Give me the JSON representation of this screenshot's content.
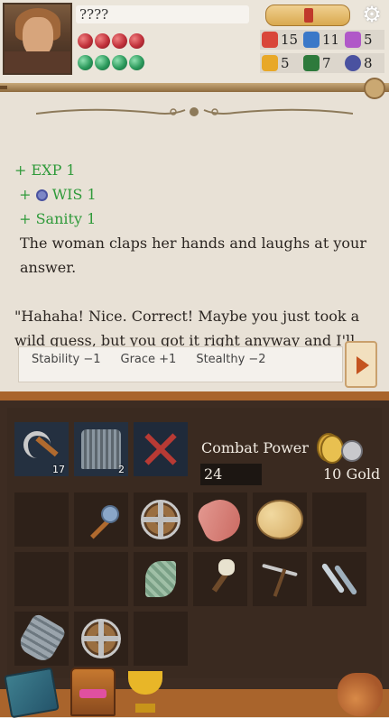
{
  "header": {
    "player_name": "????",
    "health_gems": 4,
    "sanity_gems": 4,
    "stats": [
      {
        "icon": "strength-icon",
        "value": "15",
        "color": "#d9463a"
      },
      {
        "icon": "agility-icon",
        "value": "11",
        "color": "#3a78c8"
      },
      {
        "icon": "magic-icon",
        "value": "5",
        "color": "#b058c8"
      },
      {
        "icon": "luck-icon",
        "value": "5",
        "color": "#e8a828"
      },
      {
        "icon": "defense-icon",
        "value": "7",
        "color": "#2e7a3c"
      },
      {
        "icon": "wisdom-icon",
        "value": "8",
        "color": "#4a52a0"
      }
    ]
  },
  "story": {
    "rewards": [
      {
        "prefix": "+ ",
        "label": "EXP 1",
        "icon": null
      },
      {
        "prefix": "+ ",
        "label": "WIS 1",
        "icon": "wisdom-icon"
      },
      {
        "prefix": "+ ",
        "label": "Sanity 1",
        "icon": null
      }
    ],
    "paragraphs": [
      "The woman claps her hands and laughs at your answer.",
      "\"Hahaha! Nice. Correct! Maybe you just took a wild guess, but you got it right anyway and I'll"
    ]
  },
  "choice": {
    "effects": [
      "Stability −1",
      "Grace +1",
      "Stealthy −2"
    ]
  },
  "inventory": {
    "equipment": [
      {
        "name": "scythe-item",
        "count": "17"
      },
      {
        "name": "chainmail-item",
        "count": "2"
      },
      {
        "name": "empty-equipment-slot",
        "count": ""
      }
    ],
    "combat_power_label": "Combat Power",
    "combat_power_value": "24",
    "gold_label": "10 Gold",
    "items": [
      {
        "name": "empty-slot"
      },
      {
        "name": "mace-item"
      },
      {
        "name": "round-shield-item"
      },
      {
        "name": "fish-item"
      },
      {
        "name": "bread-item"
      },
      {
        "name": "empty-slot"
      },
      {
        "name": "empty-slot"
      },
      {
        "name": "empty-slot"
      },
      {
        "name": "herb-leaf-item"
      },
      {
        "name": "skull-staff-item"
      },
      {
        "name": "pickaxe-item"
      },
      {
        "name": "throwing-knives-item"
      },
      {
        "name": "gauntlet-item"
      },
      {
        "name": "round-shield-item"
      },
      {
        "name": "empty-slot"
      }
    ]
  },
  "bottom_nav": [
    "journal-book-icon",
    "treasure-chest-icon",
    "trophy-icon",
    "coin-bag-icon"
  ],
  "colors": {
    "accent": "#a9642c",
    "gain_green": "#2f9a3a",
    "panel_bg": "#3d2c22"
  }
}
